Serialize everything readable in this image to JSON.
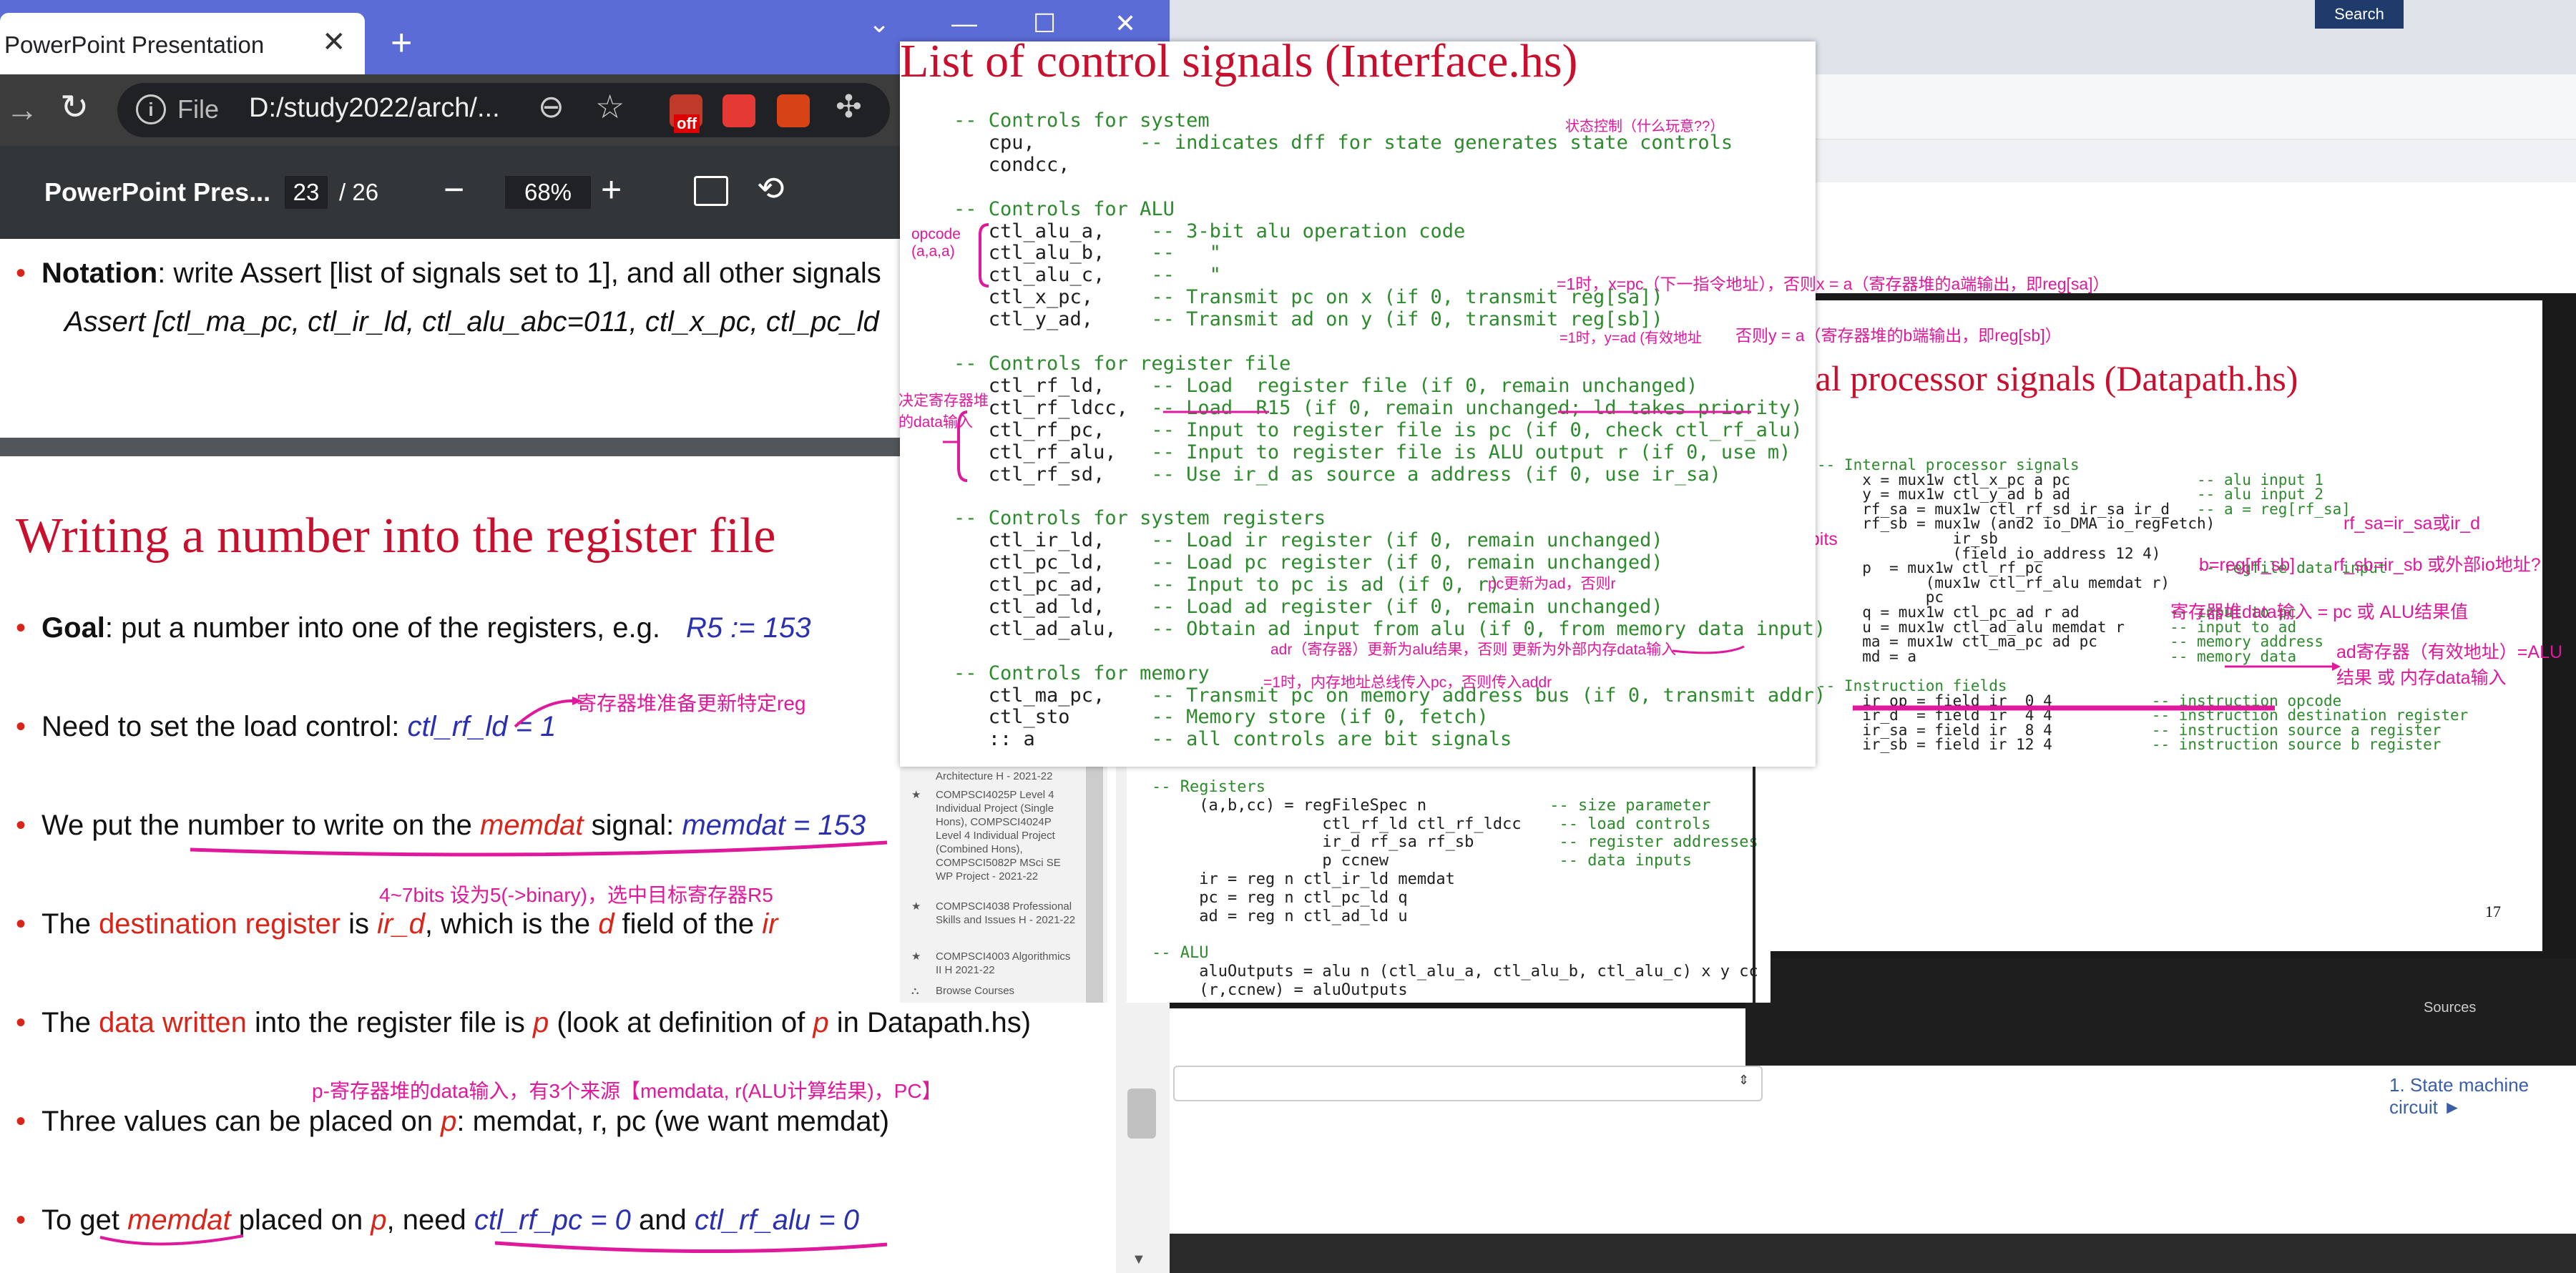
{
  "browser_left": {
    "tab_title": "PowerPoint Presentation",
    "tab_close": "✕",
    "new_tab": "+",
    "window_controls": [
      "⌄",
      "—",
      "☐",
      "✕"
    ],
    "url_scheme": "File",
    "url": "D:/study2022/arch/...",
    "extension_off_label": "off"
  },
  "pdf_viewer": {
    "title": "PowerPoint Pres...",
    "page_current": "23",
    "page_total": "/ 26",
    "zoom": "68%",
    "zoom_out": "−",
    "zoom_in": "+"
  },
  "slide_prev": {
    "notation_bold": "Notation",
    "notation_text": ": write Assert [list of signals set to 1], and all other signals",
    "assert_text": "Assert [ctl_ma_pc, ctl_ir_ld, ctl_alu_abc=011, ctl_x_pc, ctl_pc_ld"
  },
  "slide": {
    "heading": "Writing a number into the register file",
    "goal_bold": "Goal",
    "goal_text": ": put a number into one of the registers, e.g.",
    "goal_example": "R5 := 153",
    "load_text": "Need to set the load control: ",
    "load_signal": "ctl_rf_ld = 1",
    "put_a": "We put the ",
    "put_b": "number to write",
    "put_c": " on the ",
    "put_d": "memdat",
    "put_e": " signal: ",
    "put_f": "memdat = 153",
    "dest_a": "The ",
    "dest_b": "destination register",
    "dest_c": " is ",
    "dest_d": "ir_d",
    "dest_e": ", which is the ",
    "dest_f": "d",
    "dest_g": " field of the ",
    "dest_h": "ir",
    "data_a": "The ",
    "data_b": "data written",
    "data_c": " into the register file is ",
    "data_d": "p",
    "data_e": " (look at definition of ",
    "data_f": "p",
    "data_g": " in Datapath.hs)",
    "three_a": "Three values can be placed on ",
    "three_b": "p",
    "three_c": ": memdat, r, pc (we want memdat)",
    "get_a": "To ",
    "get_b": "get ",
    "get_c": "memdat",
    "get_d": " placed on ",
    "get_e": "p",
    "get_f": ", need ",
    "get_g": "ctl_rf_pc = 0",
    "get_h": " and ",
    "get_i": "ctl_rf_alu = 0"
  },
  "slide_notes": {
    "n1": "寄存器堆准备更新特定reg",
    "n2": "4~7bits 设为5(->binary)，选中目标寄存器R5",
    "n3": "p-寄存器堆的data输入，有3个来源【memdata, r(ALU计算结果)，PC】"
  },
  "overlay": {
    "title": "List of control signals (Interface.hs)",
    "code": [
      "-- Controls for system",
      "   cpu,         -- indicates dff for state generates state controls",
      "   condcc,",
      "",
      "-- Controls for ALU",
      "   ctl_alu_a,    -- 3-bit alu operation code",
      "   ctl_alu_b,    --   \"",
      "   ctl_alu_c,    --   \"",
      "   ctl_x_pc,     -- Transmit pc on x (if 0, transmit reg[sa])",
      "   ctl_y_ad,     -- Transmit ad on y (if 0, transmit reg[sb])",
      "",
      "-- Controls for register file",
      "   ctl_rf_ld,    -- Load  register file (if 0, remain unchanged)",
      "   ctl_rf_ldcc,  -- Load  R15 (if 0, remain unchanged; ld takes priority)",
      "   ctl_rf_pc,    -- Input to register file is pc (if 0, check ctl_rf_alu)",
      "   ctl_rf_alu,   -- Input to register file is ALU output r (if 0, use m)",
      "   ctl_rf_sd,    -- Use ir_d as source a address (if 0, use ir_sa)",
      "",
      "-- Controls for system registers",
      "   ctl_ir_ld,    -- Load ir register (if 0, remain unchanged)",
      "   ctl_pc_ld,    -- Load pc register (if 0, remain unchanged)",
      "   ctl_pc_ad,    -- Input to pc is ad (if 0, r)",
      "   ctl_ad_ld,    -- Load ad register (if 0, remain unchanged)",
      "   ctl_ad_alu,   -- Obtain ad input from alu (if 0, from memory data input)",
      "",
      "-- Controls for memory",
      "   ctl_ma_pc,    -- Transmit pc on memory address bus (if 0, transmit addr)",
      "   ctl_sto       -- Memory store (if 0, fetch)",
      "   :: a          -- all controls are bit signals"
    ],
    "notes": {
      "status": "状态控制（什么玩意??）",
      "opcode": "opcode\n(a,a,a)",
      "x_pc": "=1时，x=pc（下一指令地址），否则x = a（寄存器堆的a端输出，即reg[sa]）",
      "y_ad": "=1时，y=ad (有效地址",
      "y_else": "否则y = a（寄存器堆的b端输出，即reg[sb]）",
      "rf_input": "决定寄存器堆\n的data输入",
      "pc_ad": "pc更新为ad，否则r",
      "ad_alu": "adr（寄存器）更新为alu结果，否则 更新为外部内存data输入",
      "ma_pc": "=1时，内存地址总线传入pc，否则传入addr"
    }
  },
  "mid_panel": {
    "sidebar": [
      "Architecture H - 2021-22",
      "COMPSCI4025P Level 4 Individual Project (Single Hons), COMPSCI4024P Level 4 Individual Project (Combined Hons), COMPSCI5082P MSci SE WP Project - 2021-22",
      "COMPSCI4038 Professional Skills and Issues H - 2021-22",
      "COMPSCI4003 Algorithmics II H 2021-22",
      "Browse Courses"
    ],
    "code": [
      "-- Registers",
      "     (a,b,cc) = regFileSpec n             -- size parameter",
      "                  ctl_rf_ld ctl_rf_ldcc    -- load controls",
      "                  ir_d rf_sa rf_sb         -- register addresses",
      "                  p ccnew                  -- data inputs",
      "     ir = reg n ctl_ir_ld memdat",
      "     pc = reg n ctl_pc_ld q",
      "     ad = reg n ctl_ad_ld u",
      "",
      "-- ALU",
      "     aluOutputs = alu n (ctl_alu_a, ctl_alu_b, ctl_alu_c) x y cc",
      "     (r,ccnew) = aluOutputs"
    ]
  },
  "right_window": {
    "search_label": "Search",
    "slide_title": "rnal processor signals (Datapath.hs)",
    "slide_number": "17",
    "code": [
      "-- Internal processor signals",
      "     x = mux1w ctl_x_pc a pc              -- alu input 1",
      "     y = mux1w ctl_y_ad b ad              -- alu input 2",
      "     rf_sa = mux1w ctl_rf_sd ir_sa ir_d   -- a = reg[rf_sa]",
      "     rf_sb = mux1w (and2 io_DMA io_regFetch)",
      "               ir_sb",
      "               (field io_address 12 4)",
      "     p  = mux1w ctl_rf_pc                 -- regfile data input",
      "            (mux1w ctl_rf_alu memdat r)",
      "            pc",
      "     q = mux1w ctl_pc_ad r ad          -- input to pc",
      "     u = mux1w ctl_ad_alu memdat r     -- input to ad",
      "     ma = mux1w ctl_ma_pc ad pc        -- memory address",
      "     md = a                            -- memory data",
      "",
      "-- Instruction fields",
      "     ir_op = field ir  0 4           -- instruction opcode",
      "     ir_d  = field ir  4 4           -- instruction destination register",
      "     ir_sa = field ir  8 4           -- instruction source a register",
      "     ir_sb = field ir 12 4           -- instruction source b register"
    ],
    "notes": {
      "rf_sa": "rf_sa=ir_sa或ir_d",
      "four_bits": "4bits",
      "rf_sb_eq": "b=reg[rf_sb]",
      "rf_sb": "rf_sb=ir_sb 或外部io地址?",
      "p_note": "寄存器堆data输入 = pc 或 ALU结果值",
      "ad_note": "ad寄存器（有效地址）=ALU\n结果 或 内存data输入"
    },
    "sources_label": "Sources",
    "state_link": "1. State machine circuit ►"
  }
}
